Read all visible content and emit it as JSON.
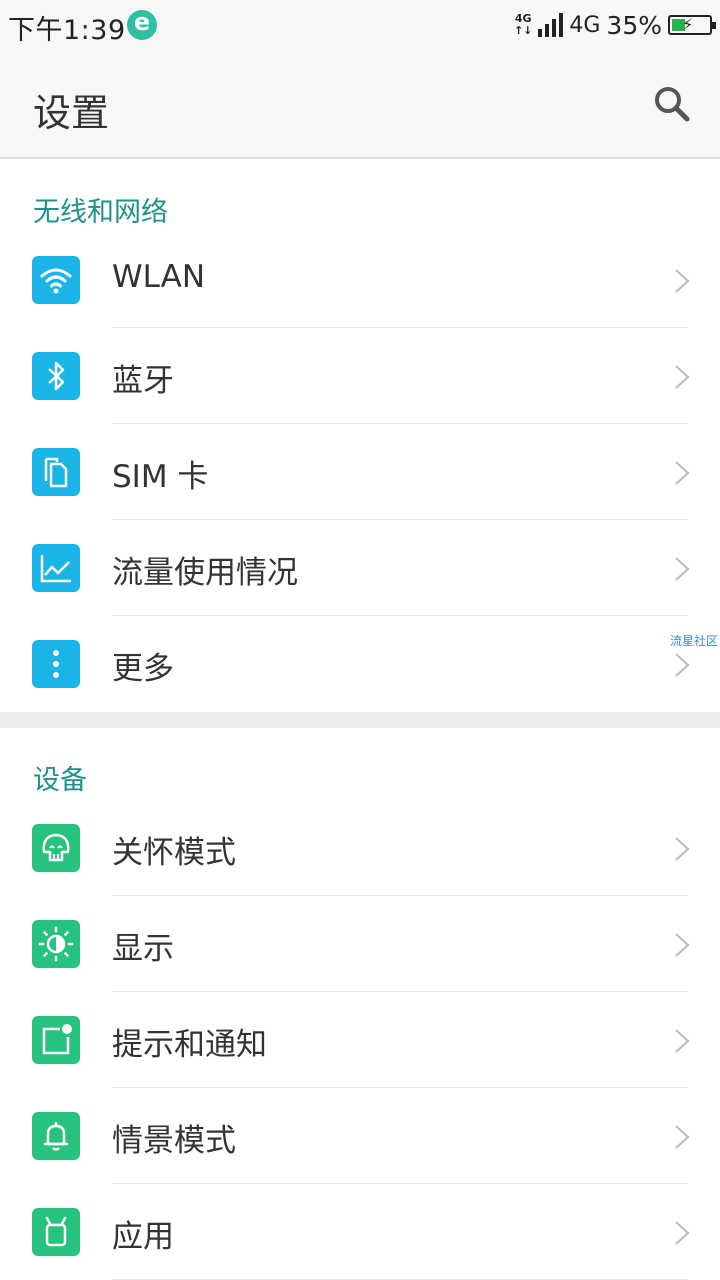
{
  "status_bar": {
    "time": "下午1:39",
    "app_icon": "e-browser-icon",
    "net_small_top": "4G",
    "net_small_bottom": "↑↓",
    "network": "4G",
    "battery_text": "35%",
    "battery_level": 0.35
  },
  "app_bar": {
    "title": "设置",
    "search_icon": "search-icon"
  },
  "sections": [
    {
      "header": "无线和网络",
      "items": [
        {
          "label": "WLAN",
          "icon": "wifi-icon"
        },
        {
          "label": "蓝牙",
          "icon": "bluetooth-icon"
        },
        {
          "label": "SIM 卡",
          "icon": "sim-card-icon"
        },
        {
          "label": "流量使用情况",
          "icon": "data-usage-icon"
        },
        {
          "label": "更多",
          "icon": "more-icon"
        }
      ]
    },
    {
      "header": "设备",
      "items": [
        {
          "label": "关怀模式",
          "icon": "care-mode-icon"
        },
        {
          "label": "显示",
          "icon": "display-icon"
        },
        {
          "label": "提示和通知",
          "icon": "notification-icon"
        },
        {
          "label": "情景模式",
          "icon": "bell-icon"
        },
        {
          "label": "应用",
          "icon": "android-icon"
        }
      ]
    }
  ],
  "watermark": "流星社区",
  "colors": {
    "accent": "#1e9188",
    "icon_blue": "#1bb4e6",
    "icon_green": "#26c27e"
  }
}
